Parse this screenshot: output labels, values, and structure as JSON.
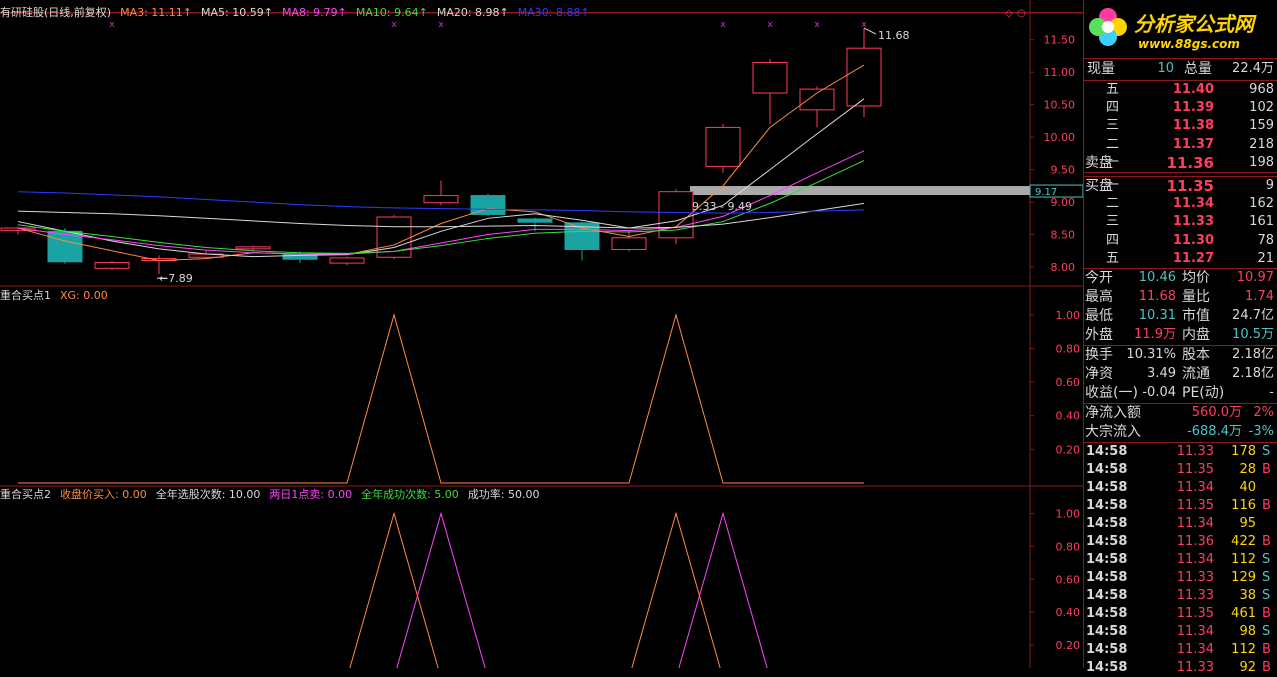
{
  "main_header": [
    {
      "text": "有研硅股(日线,前复权)",
      "color": "#d8d8d8"
    },
    {
      "text": "MA3: 11.11↑",
      "color": "#ff8a3d"
    },
    {
      "text": "MA5: 10.59↑",
      "color": "#d8d8d8"
    },
    {
      "text": "MA8: 9.79↑",
      "color": "#ff44ff"
    },
    {
      "text": "MA10: 9.64↑",
      "color": "#3ddc3d"
    },
    {
      "text": "MA20: 8.98↑",
      "color": "#d8d8d8"
    },
    {
      "text": "MA30: 8.88↑",
      "color": "#2a3dff"
    }
  ],
  "ind1_header": [
    {
      "text": "重合买点1",
      "color": "#d8d8d8"
    },
    {
      "text": "XG: 0.00",
      "color": "#ff8a3d"
    }
  ],
  "ind2_header": [
    {
      "text": "重合买点2",
      "color": "#d8d8d8"
    },
    {
      "text": "收盘价买入: 0.00",
      "color": "#ff8a3d"
    },
    {
      "text": "全年选股次数: 10.00",
      "color": "#d8d8d8"
    },
    {
      "text": "两日1点卖: 0.00",
      "color": "#ff44ff"
    },
    {
      "text": "全年成功次数: 5.00",
      "color": "#3ddc3d"
    },
    {
      "text": "成功率: 50.00",
      "color": "#d8d8d8"
    }
  ],
  "chart_data": [
    {
      "type": "candlestick",
      "title": "有研硅股(日线,前复权)",
      "ylim": [
        7.8,
        11.65
      ],
      "yticks": [
        "11.50",
        "11.00",
        "10.50",
        "10.00",
        "9.50",
        "9.00",
        "8.50",
        "8.00"
      ],
      "yticks_values": [
        11.5,
        11.0,
        10.5,
        10.0,
        9.5,
        9.0,
        8.5,
        8.0
      ],
      "current_price_label": "9.17",
      "annotations": {
        "high": "11.68",
        "low": "7.89",
        "range": "9.33 - 9.49"
      },
      "candles": [
        {
          "o": 8.56,
          "c": 8.6,
          "h": 8.62,
          "l": 8.5
        },
        {
          "o": 8.55,
          "c": 8.08,
          "h": 8.6,
          "l": 8.05
        },
        {
          "o": 7.98,
          "c": 8.07,
          "h": 8.09,
          "l": 7.95
        },
        {
          "o": 8.1,
          "c": 8.13,
          "h": 8.18,
          "l": 7.89
        },
        {
          "o": 8.15,
          "c": 8.2,
          "h": 8.26,
          "l": 8.12
        },
        {
          "o": 8.28,
          "c": 8.31,
          "h": 8.33,
          "l": 8.24
        },
        {
          "o": 8.2,
          "c": 8.12,
          "h": 8.24,
          "l": 8.06
        },
        {
          "o": 8.06,
          "c": 8.14,
          "h": 8.16,
          "l": 8.03
        },
        {
          "o": 8.15,
          "c": 8.77,
          "h": 8.8,
          "l": 8.12
        },
        {
          "o": 8.99,
          "c": 9.1,
          "h": 9.33,
          "l": 8.95
        },
        {
          "o": 9.1,
          "c": 8.81,
          "h": 9.13,
          "l": 8.78
        },
        {
          "o": 8.74,
          "c": 8.69,
          "h": 8.76,
          "l": 8.55
        },
        {
          "o": 8.68,
          "c": 8.27,
          "h": 8.7,
          "l": 8.1
        },
        {
          "o": 8.27,
          "c": 8.45,
          "h": 8.57,
          "l": 8.24
        },
        {
          "o": 8.45,
          "c": 9.16,
          "h": 9.2,
          "l": 8.35
        },
        {
          "o": 9.55,
          "c": 10.15,
          "h": 10.2,
          "l": 9.45
        },
        {
          "o": 10.68,
          "c": 11.15,
          "h": 11.2,
          "l": 10.2
        },
        {
          "o": 10.42,
          "c": 10.74,
          "h": 10.78,
          "l": 10.15
        },
        {
          "o": 10.48,
          "c": 11.37,
          "h": 11.68,
          "l": 10.31
        }
      ],
      "series": [
        {
          "name": "MA3",
          "color": "#ff8a3d",
          "values": [
            8.6,
            8.4,
            8.25,
            8.1,
            8.13,
            8.22,
            8.2,
            8.19,
            8.34,
            8.67,
            8.9,
            8.85,
            8.6,
            8.47,
            8.62,
            9.25,
            10.15,
            10.68,
            11.11
          ]
        },
        {
          "name": "MA5",
          "color": "#d8d8d8",
          "values": [
            8.7,
            8.55,
            8.4,
            8.28,
            8.2,
            8.16,
            8.18,
            8.19,
            8.3,
            8.55,
            8.75,
            8.82,
            8.72,
            8.6,
            8.71,
            8.95,
            9.5,
            10.05,
            10.59
          ]
        },
        {
          "name": "MA8",
          "color": "#ff44ff",
          "values": [
            8.6,
            8.5,
            8.42,
            8.33,
            8.26,
            8.22,
            8.2,
            8.2,
            8.24,
            8.37,
            8.5,
            8.58,
            8.58,
            8.56,
            8.61,
            8.78,
            9.1,
            9.45,
            9.79
          ]
        },
        {
          "name": "MA10",
          "color": "#3ddc3d",
          "values": [
            8.65,
            8.55,
            8.47,
            8.38,
            8.3,
            8.25,
            8.22,
            8.21,
            8.24,
            8.33,
            8.44,
            8.52,
            8.55,
            8.54,
            8.57,
            8.7,
            8.98,
            9.3,
            9.64
          ]
        },
        {
          "name": "MA20",
          "color": "#d8d8d8",
          "values": [
            8.86,
            8.84,
            8.82,
            8.79,
            8.75,
            8.71,
            8.67,
            8.64,
            8.62,
            8.62,
            8.63,
            8.64,
            8.62,
            8.6,
            8.61,
            8.66,
            8.76,
            8.87,
            8.98
          ]
        },
        {
          "name": "MA30",
          "color": "#2a3dff",
          "values": [
            9.16,
            9.14,
            9.11,
            9.08,
            9.04,
            9.0,
            8.96,
            8.93,
            8.91,
            8.9,
            8.89,
            8.88,
            8.87,
            8.85,
            8.84,
            8.83,
            8.84,
            8.86,
            8.88
          ]
        }
      ]
    },
    {
      "type": "line",
      "title": "重合买点1",
      "ylim": [
        0,
        1.1
      ],
      "yticks": [
        "1.00",
        "0.80",
        "0.60",
        "0.40",
        "0.20"
      ],
      "yticks_values": [
        1.0,
        0.8,
        0.6,
        0.4,
        0.2
      ],
      "series": [
        {
          "name": "XG",
          "color": "#ff8a3d",
          "values": [
            0,
            0,
            0,
            0,
            0,
            0,
            0,
            0,
            1,
            0,
            0,
            0,
            0,
            0,
            1,
            0,
            0,
            0,
            0
          ]
        }
      ]
    },
    {
      "type": "line",
      "title": "重合买点2",
      "ylim": [
        0,
        1.1
      ],
      "yticks": [
        "1.00",
        "0.80",
        "0.60",
        "0.40",
        "0.20"
      ],
      "yticks_values": [
        1.0,
        0.8,
        0.6,
        0.4,
        0.2
      ],
      "series": [
        {
          "name": "收盘价买入",
          "color": "#ff8a3d",
          "values": [
            0,
            0,
            0,
            0,
            0,
            0,
            0,
            0,
            1,
            0,
            0,
            0,
            0,
            0,
            1,
            0,
            0,
            0,
            0
          ]
        },
        {
          "name": "两日1点卖",
          "color": "#ff44ff",
          "values": [
            0,
            0,
            0,
            0,
            0,
            0,
            0,
            0,
            0,
            1,
            0,
            0,
            0,
            0,
            0,
            1,
            0,
            0,
            0
          ]
        }
      ]
    }
  ],
  "panel": {
    "logo_title": "分析家公式网",
    "logo_url": "www.88gs.com",
    "top": {
      "l1": "现量",
      "v1": "10",
      "l2": "总量",
      "v2": "22.4万"
    },
    "asks": [
      {
        "label": "五",
        "price": "11.40",
        "vol": "968"
      },
      {
        "label": "四",
        "price": "11.39",
        "vol": "102"
      },
      {
        "label": "三",
        "price": "11.38",
        "vol": "159"
      },
      {
        "label": "二",
        "price": "11.37",
        "vol": "218"
      },
      {
        "label": "一",
        "price": "11.36",
        "vol": "198",
        "prefix": "卖盘"
      }
    ],
    "bids": [
      {
        "label": "一",
        "price": "11.35",
        "vol": "9",
        "prefix": "买盘"
      },
      {
        "label": "二",
        "price": "11.34",
        "vol": "162"
      },
      {
        "label": "三",
        "price": "11.33",
        "vol": "161"
      },
      {
        "label": "四",
        "price": "11.30",
        "vol": "78"
      },
      {
        "label": "五",
        "price": "11.27",
        "vol": "21"
      }
    ],
    "stats": [
      {
        "l1": "今开",
        "v1": "10.46",
        "c1": "cyan",
        "l2": "均价",
        "v2": "10.97",
        "c2": "red"
      },
      {
        "l1": "最高",
        "v1": "11.68",
        "c1": "red",
        "l2": "量比",
        "v2": "1.74",
        "c2": "red"
      },
      {
        "l1": "最低",
        "v1": "10.31",
        "c1": "cyan",
        "l2": "市值",
        "v2": "24.7亿",
        "c2": "w"
      },
      {
        "l1": "外盘",
        "v1": "11.9万",
        "c1": "red",
        "l2": "内盘",
        "v2": "10.5万",
        "c2": "cyan"
      }
    ],
    "stats2": [
      {
        "l1": "换手",
        "v1": "10.31%",
        "l2": "股本",
        "v2": "2.18亿"
      },
      {
        "l1": "净资",
        "v1": "3.49",
        "l2": "流通",
        "v2": "2.18亿"
      },
      {
        "l1": "收益(一)",
        "v1": "-0.04",
        "l2": "PE(动)",
        "v2": "-"
      }
    ],
    "flows": [
      {
        "label": "净流入额",
        "value": "560.0万",
        "pct": "2%",
        "color": "red"
      },
      {
        "label": "大宗流入",
        "value": "-688.4万",
        "pct": "-3%",
        "color": "cyan"
      }
    ],
    "ticks": [
      {
        "time": "14:58",
        "price": "11.33",
        "vol": "178",
        "side": "S"
      },
      {
        "time": "14:58",
        "price": "11.35",
        "vol": "28",
        "side": "B"
      },
      {
        "time": "14:58",
        "price": "11.34",
        "vol": "40",
        "side": ""
      },
      {
        "time": "14:58",
        "price": "11.35",
        "vol": "116",
        "side": "B"
      },
      {
        "time": "14:58",
        "price": "11.34",
        "vol": "95",
        "side": ""
      },
      {
        "time": "14:58",
        "price": "11.36",
        "vol": "422",
        "side": "B"
      },
      {
        "time": "14:58",
        "price": "11.34",
        "vol": "112",
        "side": "S"
      },
      {
        "time": "14:58",
        "price": "11.33",
        "vol": "129",
        "side": "S"
      },
      {
        "time": "14:58",
        "price": "11.33",
        "vol": "38",
        "side": "S"
      },
      {
        "time": "14:58",
        "price": "11.35",
        "vol": "461",
        "side": "B"
      },
      {
        "time": "14:58",
        "price": "11.34",
        "vol": "98",
        "side": "S"
      },
      {
        "time": "14:58",
        "price": "11.34",
        "vol": "112",
        "side": "B"
      },
      {
        "time": "14:58",
        "price": "11.33",
        "vol": "92",
        "side": "B"
      }
    ]
  }
}
